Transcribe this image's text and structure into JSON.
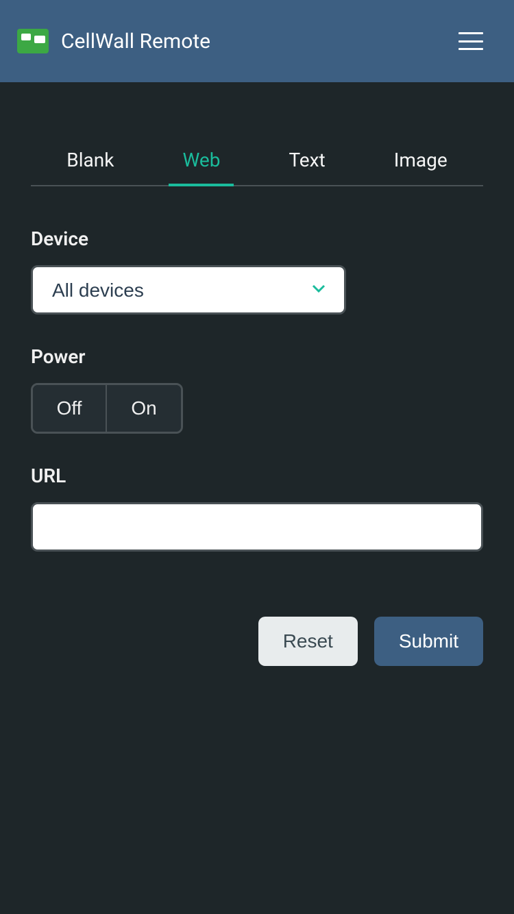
{
  "header": {
    "app_title": "CellWall Remote"
  },
  "tabs": [
    {
      "label": "Blank",
      "active": false
    },
    {
      "label": "Web",
      "active": true
    },
    {
      "label": "Text",
      "active": false
    },
    {
      "label": "Image",
      "active": false
    }
  ],
  "form": {
    "device": {
      "label": "Device",
      "selected": "All devices"
    },
    "power": {
      "label": "Power",
      "off": "Off",
      "on": "On"
    },
    "url": {
      "label": "URL",
      "value": ""
    }
  },
  "buttons": {
    "reset": "Reset",
    "submit": "Submit"
  }
}
